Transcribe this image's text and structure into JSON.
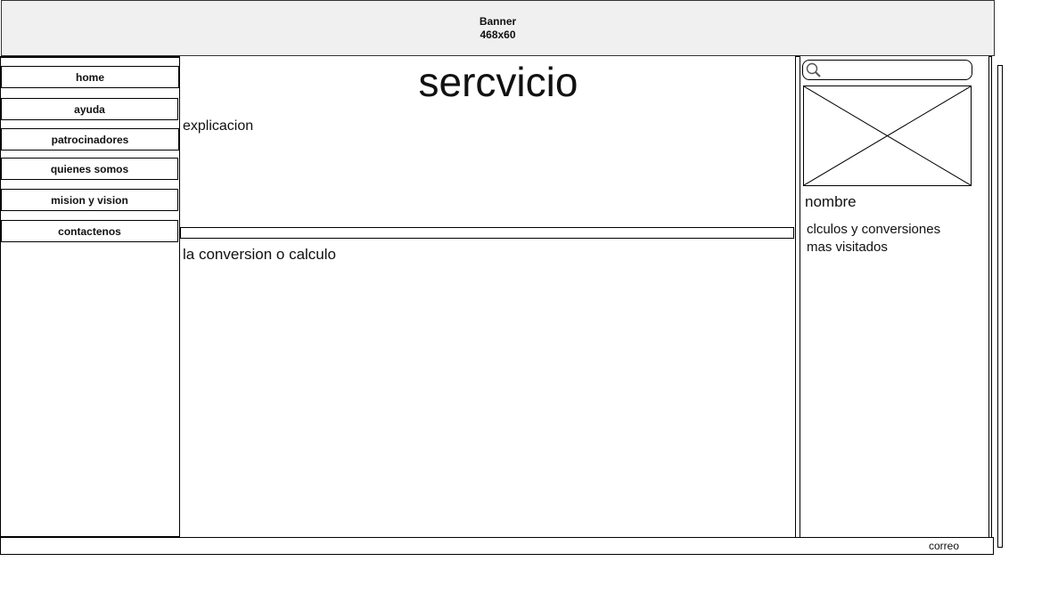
{
  "banner": {
    "line1": "Banner",
    "line2": "468x60"
  },
  "nav": {
    "items": [
      {
        "label": "home"
      },
      {
        "label": "ayuda"
      },
      {
        "label": "patrocinadores"
      },
      {
        "label": "quienes somos"
      },
      {
        "label": "mision y vision"
      },
      {
        "label": "contactenos"
      }
    ]
  },
  "main": {
    "title": "sercvicio",
    "explanation": "explicacion",
    "result_label": "la conversion o calculo"
  },
  "sidebar": {
    "search_icon": "search-icon",
    "name_label": "nombre",
    "visited_line1": "clculos y conversiones",
    "visited_line2": "mas visitados"
  },
  "footer": {
    "email": "correo"
  }
}
